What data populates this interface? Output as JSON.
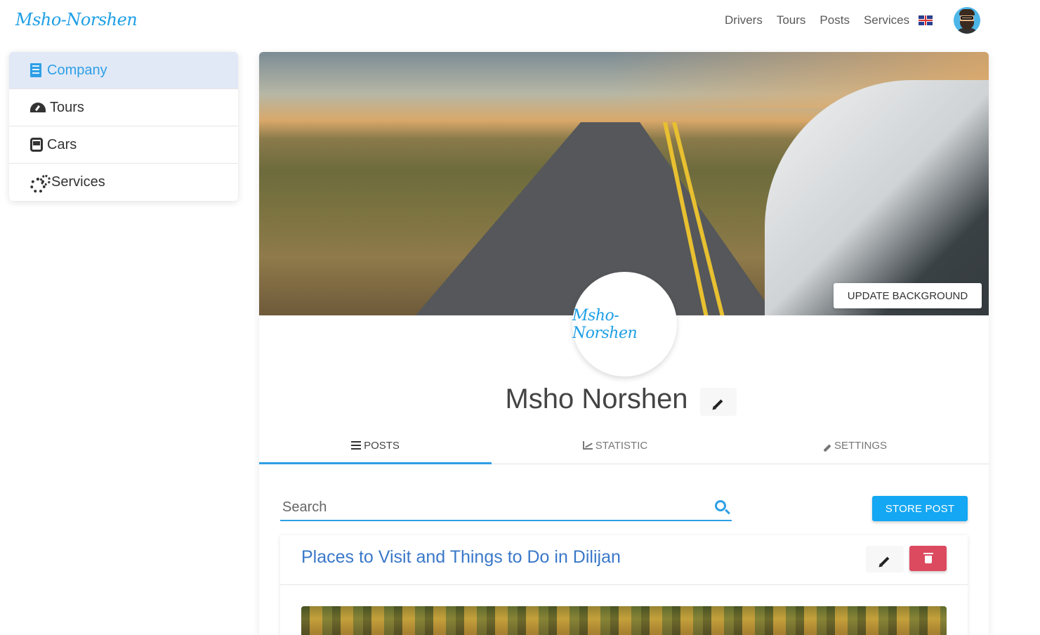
{
  "brand": {
    "name": "Msho-Norshen"
  },
  "nav": {
    "links": [
      "Drivers",
      "Tours",
      "Posts",
      "Services"
    ],
    "language_flag": "uk-flag-icon"
  },
  "sidebar": {
    "items": [
      {
        "label": "Company",
        "icon": "building-icon",
        "active": true
      },
      {
        "label": "Tours",
        "icon": "gauge-icon",
        "active": false
      },
      {
        "label": "Cars",
        "icon": "bus-icon",
        "active": false
      },
      {
        "label": "Services",
        "icon": "cogs-icon",
        "active": false
      }
    ]
  },
  "profile": {
    "update_background_label": "UPDATE BACKGROUND",
    "logo_text": "Msho-Norshen",
    "company_name": "Msho Norshen"
  },
  "tabs": [
    {
      "label": "POSTS",
      "icon": "list-icon",
      "active": true
    },
    {
      "label": "STATISTIC",
      "icon": "chart-icon",
      "active": false
    },
    {
      "label": "SETTINGS",
      "icon": "wrench-icon",
      "active": false
    }
  ],
  "posts_panel": {
    "search_placeholder": "Search",
    "store_post_label": "STORE POST",
    "posts": [
      {
        "title": "Places to Visit and Things to Do in Dilijan"
      }
    ]
  },
  "colors": {
    "accent": "#2e9fe6",
    "store_button": "#14a7f3",
    "delete_button": "#dc4a5f",
    "post_title": "#3a78c8",
    "active_sidebar_bg": "#e1e9f6"
  }
}
